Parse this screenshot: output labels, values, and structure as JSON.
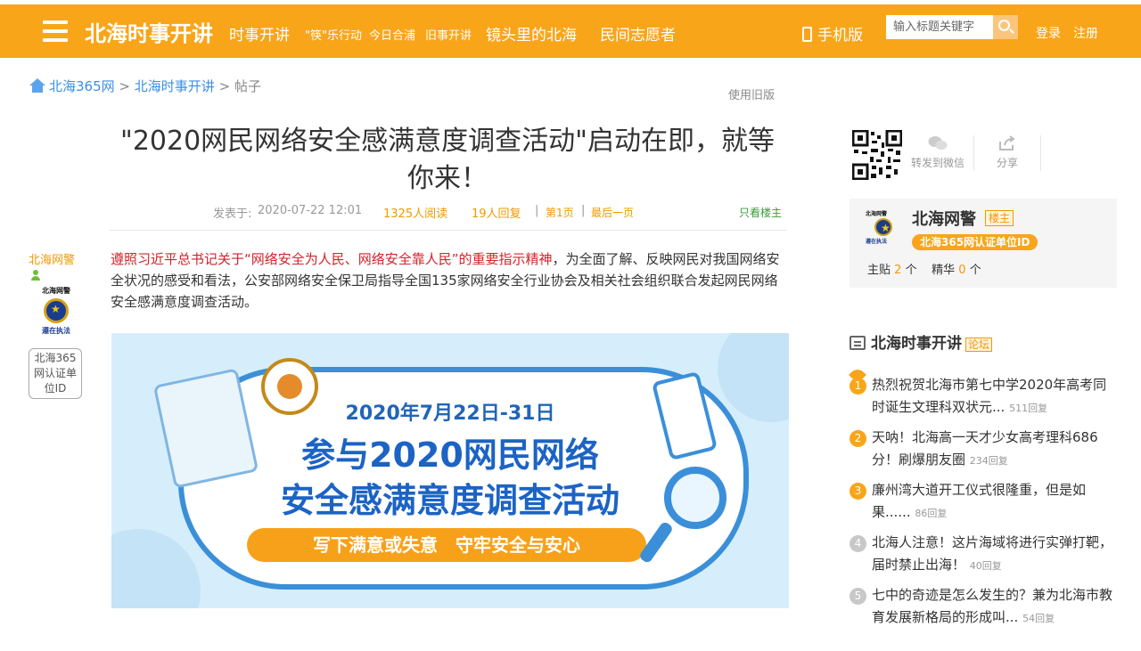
{
  "header": {
    "logo": "北海时事开讲",
    "nav": [
      {
        "label": "时事开讲"
      },
      {
        "label": "\"筷\"乐行动"
      },
      {
        "label": "今日合浦"
      },
      {
        "label": "旧事开讲"
      },
      {
        "label": "镜头里的北海"
      },
      {
        "label": "民间志愿者"
      }
    ],
    "mobile": "手机版",
    "search_placeholder": "输入标题关键字",
    "login": "登录",
    "register": "注册",
    "accent": "#f9a51a"
  },
  "breadcrumb": {
    "home": "北海365网",
    "forum": "北海时事开讲",
    "current": "帖子",
    "sep": ">"
  },
  "old_version": "使用旧版",
  "post": {
    "title": "\"2020网民网络安全感满意度调查活动\"启动在即，就等你来！",
    "posted_prefix": "发表于:",
    "posted_at": "2020-07-22 12:01",
    "reads": "1325人阅读",
    "replies": "19人回复",
    "page": "第1页",
    "last_page": "最后一页",
    "only_owner": "只看楼主",
    "author": "北海网警",
    "author_badge_top": "北海网警",
    "author_badge_bottom": "遵在执法",
    "author_tag": "北海365网认证单位ID",
    "content_red": "遵照习近平总书记关于“网络安全为人民、网络安全靠人民”的重要指示精神",
    "content_rest": "，为全面了解、反映网民对我国网络安全状况的感受和看法，公安部网络安全保卫局指导全国135家网络安全行业协会及相关社会组织联合发起网民网络安全感满意度调查活动。",
    "banner": {
      "date": "2020年7月22日-31日",
      "line2": "参与2020网民网络",
      "line3": "安全感满意度调查活动",
      "slogan": "写下满意或失意　守牢安全与安心"
    }
  },
  "sidebar": {
    "share_wechat": "转发到微信",
    "share": "分享",
    "user": {
      "name": "北海网警",
      "owner_tag": "楼主",
      "cert": "北海365网认证单位ID",
      "posts_label": "主贴",
      "posts": "2",
      "posts_unit": "个",
      "featured_label": "精华",
      "featured": "0",
      "featured_unit": "个"
    },
    "forum": {
      "name": "北海时事开讲",
      "tag": "论坛"
    },
    "hot": [
      {
        "num": "1",
        "title": "热烈祝贺北海市第七中学2020年高考同时诞生文理科双状元...",
        "replies": "511回复"
      },
      {
        "num": "2",
        "title": "天呐！北海高一天才少女高考理科686分！刷爆朋友圈",
        "replies": "234回复"
      },
      {
        "num": "3",
        "title": "廉州湾大道开工仪式很隆重，但是如果......",
        "replies": "86回复"
      },
      {
        "num": "4",
        "title": "北海人注意！这片海域将进行实弹打靶，届时禁止出海！",
        "replies": "40回复"
      },
      {
        "num": "5",
        "title": "七中的奇迹是怎么发生的？兼为北海市教育发展新格局的形成叫...",
        "replies": "54回复"
      }
    ]
  }
}
